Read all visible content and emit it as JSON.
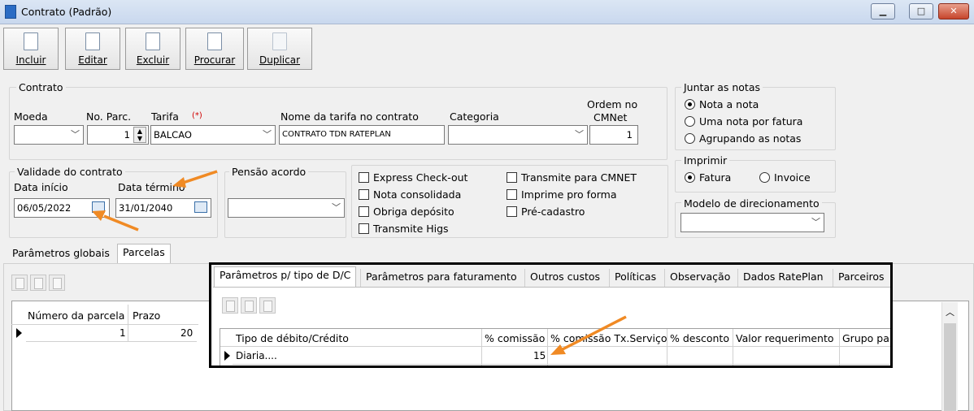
{
  "window": {
    "title": "Contrato (Padrão)",
    "min": "▁",
    "max": "□",
    "close": "✕"
  },
  "toolbar": [
    {
      "label": "Incluir",
      "icon": "new-document-icon",
      "enabled": true
    },
    {
      "label": "Editar",
      "icon": "edit-document-icon",
      "enabled": true
    },
    {
      "label": "Excluir",
      "icon": "delete-document-icon",
      "enabled": true
    },
    {
      "label": "Procurar",
      "icon": "search-document-icon",
      "enabled": true
    },
    {
      "label": "Duplicar",
      "icon": "duplicate-document-icon",
      "enabled": false
    }
  ],
  "contrato": {
    "group_label": "Contrato",
    "moeda_label": "Moeda",
    "moeda_value": "",
    "parc_label": "No. Parc.",
    "parc_value": "1",
    "tarifa_label": "Tarifa",
    "required_mark": "(*)",
    "tarifa_value": "BALCAO",
    "nome_tarifa_label": "Nome da tarifa no contrato",
    "nome_tarifa_value": "CONTRATO TDN RATEPLAN",
    "categoria_label": "Categoria",
    "categoria_value": "",
    "ordem_label_1": "Ordem no",
    "ordem_label_2": "CMNet",
    "ordem_value": "1"
  },
  "juntar": {
    "group_label": "Juntar as notas",
    "options": [
      "Nota a nota",
      "Uma nota por fatura",
      "Agrupando as notas"
    ],
    "selected": 0
  },
  "imprimir": {
    "group_label": "Imprimir",
    "options": [
      "Fatura",
      "Invoice"
    ],
    "selected": 0
  },
  "validade": {
    "group_label": "Validade do contrato",
    "inicio_label": "Data início",
    "inicio_value": "06/05/2022",
    "termino_label": "Data término",
    "termino_value": "31/01/2040"
  },
  "pensao": {
    "group_label": "Pensão acordo",
    "value": ""
  },
  "checks_left": [
    "Express Check-out",
    "Nota consolidada",
    "Obriga depósito",
    "Transmite Higs"
  ],
  "checks_right": [
    "Transmite para CMNET",
    "Imprime pro forma",
    "Pré-cadastro"
  ],
  "modelo": {
    "label": "Modelo de direcionamento",
    "value": ""
  },
  "outer_tabs": [
    "Parâmetros globais",
    "Parcelas"
  ],
  "outer_active": 1,
  "parcelas_grid": {
    "headers": [
      "Número da parcela",
      "Prazo"
    ],
    "rows": [
      [
        "1",
        "20"
      ]
    ]
  },
  "inner_tabs": [
    "Parâmetros p/ tipo de D/C",
    "Parâmetros para faturamento",
    "Outros custos",
    "Políticas",
    "Observação",
    "Dados RatePlan",
    "Parceiros"
  ],
  "inner_active": 0,
  "dc_grid": {
    "headers": [
      "Tipo de débito/Crédito",
      "% comissão",
      "% comissão Tx.Serviço",
      "% desconto",
      "Valor requerimento",
      "Grupo pa"
    ],
    "rows": [
      [
        "Diaria....",
        "15",
        "",
        "",
        "",
        ""
      ]
    ]
  },
  "colors": {
    "annotation_arrow": "#f08a24",
    "highlight_frame": "#000000"
  }
}
